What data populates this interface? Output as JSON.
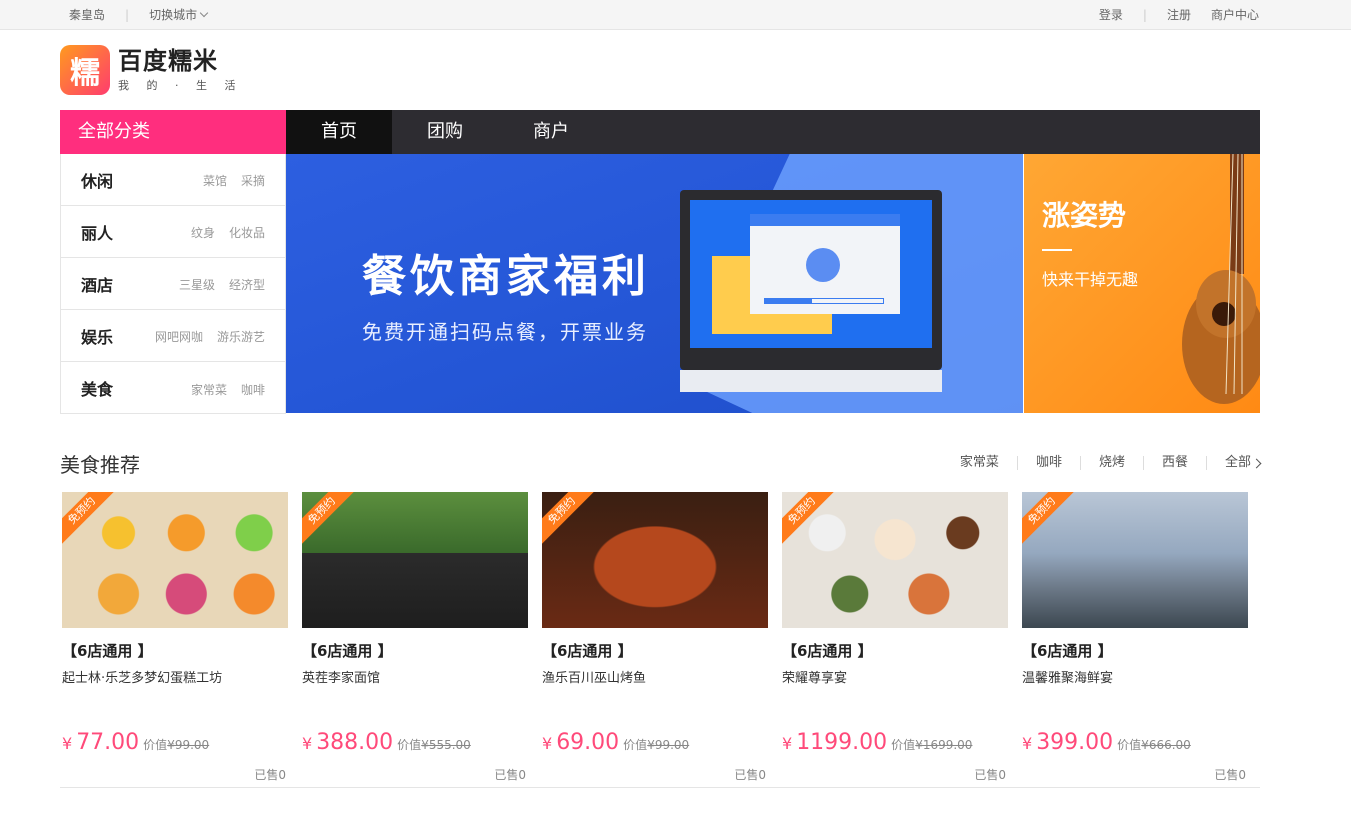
{
  "topbar": {
    "city": "秦皇岛",
    "switch_city": "切换城市",
    "login": "登录",
    "register": "注册",
    "merchant_center": "商户中心"
  },
  "logo": {
    "mark": "糯",
    "title": "百度糯米",
    "slogan": "我 的 · 生 活"
  },
  "nav": {
    "all_categories": "全部分类",
    "tabs": [
      "首页",
      "团购",
      "商户"
    ]
  },
  "categories": [
    {
      "name": "休闲",
      "tags": [
        "菜馆",
        "采摘"
      ]
    },
    {
      "name": "丽人",
      "tags": [
        "纹身",
        "化妆品"
      ]
    },
    {
      "name": "酒店",
      "tags": [
        "三星级",
        "经济型"
      ]
    },
    {
      "name": "娱乐",
      "tags": [
        "网吧网咖",
        "游乐游艺"
      ]
    },
    {
      "name": "美食",
      "tags": [
        "家常菜",
        "咖啡"
      ]
    }
  ],
  "banner_main": {
    "title": "餐饮商家福利",
    "subtitle": "免费开通扫码点餐，开票业务"
  },
  "banner_side": {
    "title": "涨姿势",
    "subtitle": "快来干掉无趣"
  },
  "section": {
    "title": "美食推荐",
    "links": [
      "家常菜",
      "咖啡",
      "烧烤",
      "西餐"
    ],
    "more": "全部"
  },
  "cards": [
    {
      "ribbon": "免预约",
      "deal": "【6店通用 】",
      "name": "起士林·乐芝多梦幻蛋糕工坊",
      "yen": "¥",
      "price": "77.00",
      "value_label": "价值",
      "original": "¥99.00",
      "sold": "已售0"
    },
    {
      "ribbon": "免预约",
      "deal": "【6店通用 】",
      "name": "英茬李家面馆",
      "yen": "¥",
      "price": "388.00",
      "value_label": "价值",
      "original": "¥555.00",
      "sold": "已售0"
    },
    {
      "ribbon": "免预约",
      "deal": "【6店通用 】",
      "name": "渔乐百川巫山烤鱼",
      "yen": "¥",
      "price": "69.00",
      "value_label": "价值",
      "original": "¥99.00",
      "sold": "已售0"
    },
    {
      "ribbon": "免预约",
      "deal": "【6店通用 】",
      "name": "荣耀尊享宴",
      "yen": "¥",
      "price": "1199.00",
      "value_label": "价值",
      "original": "¥1699.00",
      "sold": "已售0"
    },
    {
      "ribbon": "免预约",
      "deal": "【6店通用 】",
      "name": "温馨雅聚海鲜宴",
      "yen": "¥",
      "price": "399.00",
      "value_label": "价值",
      "original": "¥666.00",
      "sold": "已售0"
    }
  ],
  "colors": {
    "accent_pink": "#ff2e7e",
    "price_pink": "#ff4a7a",
    "nav_dark": "#2d2c31",
    "ribbon_orange": "#ff7b1a"
  }
}
